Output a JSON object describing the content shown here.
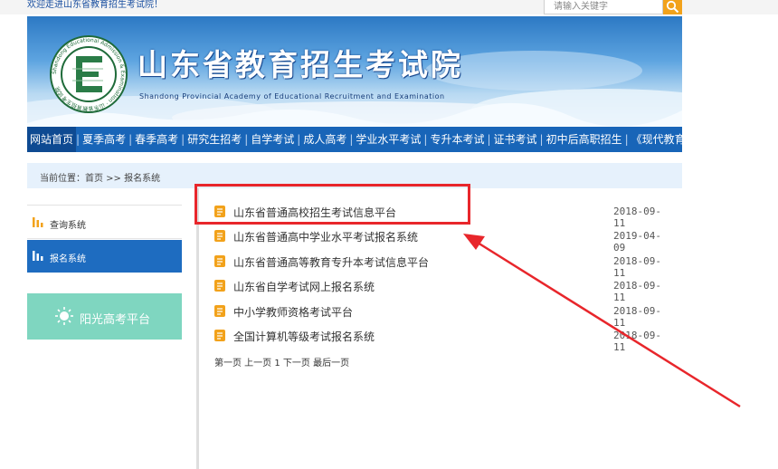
{
  "top_bar": {
    "welcome": "欢迎走进山东省教育招生考试院！",
    "search_placeholder": "请输入关键字"
  },
  "header": {
    "title": "山东省教育招生考试院",
    "subtitle": "Shandong Provincial Academy of Educational Recruitment and Examination",
    "seal_text": "Shandong Educational Admission & Examination 山东省教育招生考试院"
  },
  "nav": {
    "items": [
      {
        "label": "网站首页"
      },
      {
        "label": "夏季高考"
      },
      {
        "label": "春季高考"
      },
      {
        "label": "研究生招考"
      },
      {
        "label": "自学考试"
      },
      {
        "label": "成人高考"
      },
      {
        "label": "学业水平考试"
      },
      {
        "label": "专升本考试"
      },
      {
        "label": "证书考试"
      },
      {
        "label": "初中后高职招生"
      },
      {
        "label": "《现代教育》"
      }
    ]
  },
  "breadcrumb": {
    "text": "当前位置：首页 >> 报名系统"
  },
  "sidebar": {
    "items": [
      {
        "label": "查询系统",
        "active": false
      },
      {
        "label": "报名系统",
        "active": true
      }
    ],
    "banner_label": "阳光高考平台"
  },
  "main": {
    "items": [
      {
        "title": "山东省普通高校招生考试信息平台",
        "date": "2018-09-11"
      },
      {
        "title": "山东省普通高中学业水平考试报名系统",
        "date": "2019-04-09"
      },
      {
        "title": "山东省普通高等教育专升本考试信息平台",
        "date": "2018-09-11"
      },
      {
        "title": "山东省自学考试网上报名系统",
        "date": "2018-09-11"
      },
      {
        "title": "中小学教师资格考试平台",
        "date": "2018-09-11"
      },
      {
        "title": "全国计算机等级考试报名系统",
        "date": "2018-09-11"
      }
    ],
    "pager": "第一页 上一页 1 下一页 最后一页"
  },
  "colors": {
    "nav": "#1865b8",
    "active_sidebar": "#1e6cc0",
    "sunny_banner": "#7fd6c0",
    "annotation": "#e8262b",
    "icon": "#f2a21b"
  }
}
